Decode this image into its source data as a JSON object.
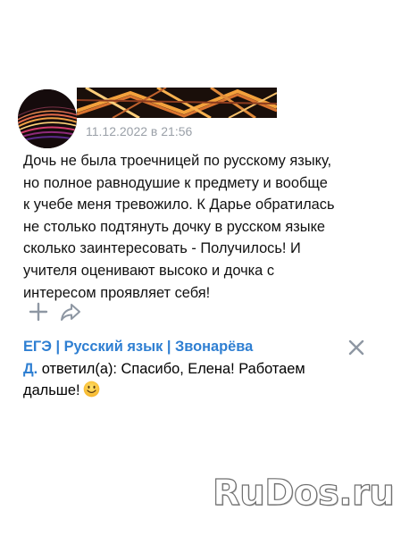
{
  "review": {
    "timestamp": "11.12.2022 в 21:56",
    "lines": [
      "Дочь не была троечницей по русскому языку,",
      "но полное равнодушие к предмету и вообще",
      "к учебе меня тревожило. К Дарье обратилась",
      "не столько подтянуть дочку в русском языке",
      "сколько заинтересовать - Получилось! И",
      "учителя оценивают высоко и дочка с",
      "интересом проявляет себя!"
    ]
  },
  "actions": {
    "add_icon": "plus-icon",
    "share_icon": "share-icon"
  },
  "reply": {
    "author_line1": "ЕГЭ | Русский язык | Звонарёва",
    "author_line2": "Д.",
    "verb_text": " ответил(а): Спасибо, Елена! Работаем",
    "text_line2": "дальше!",
    "emoji": "smiling-face-emoji",
    "close_icon": "close-icon"
  },
  "watermark": {
    "text": "RuDos.ru"
  },
  "colors": {
    "link": "#2f7fd2",
    "timestamp": "#9aa0a8",
    "icon": "#8e97a3",
    "text": "#111111"
  }
}
